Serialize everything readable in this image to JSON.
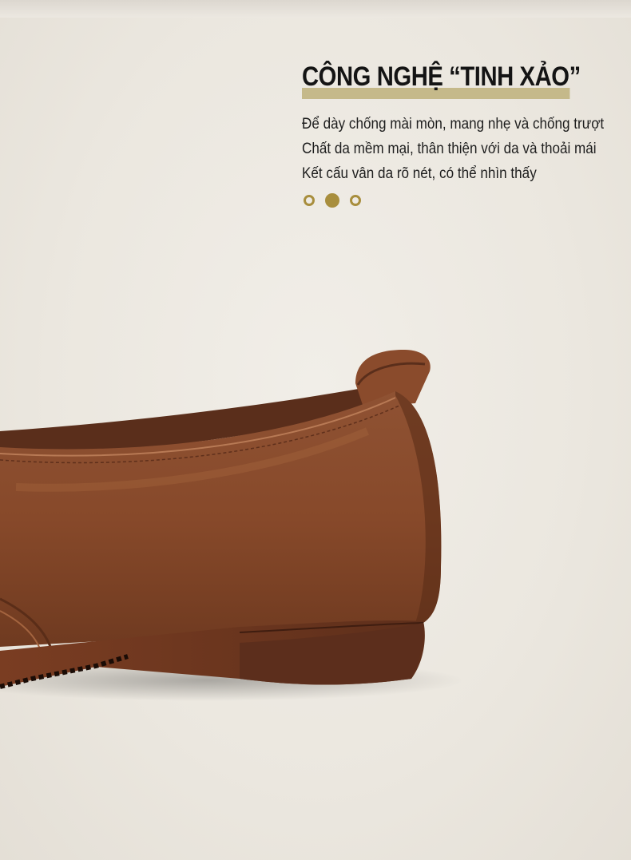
{
  "headline": "CÔNG NGHỆ “TINH XẢO”",
  "features": [
    "Để dày chống mài mòn, mang nhẹ và chống trượt",
    "Chất da mềm mại, thân thiện với da và thoải mái",
    "Kết cấu vân da rõ nét, có thể nhìn thấy"
  ],
  "carousel": {
    "active_index": 1,
    "count": 3
  },
  "colors": {
    "accent": "#a88e3d",
    "highlight": "#c5b98a",
    "leather": "#8a4a2a",
    "sole": "#5c2e1c"
  }
}
